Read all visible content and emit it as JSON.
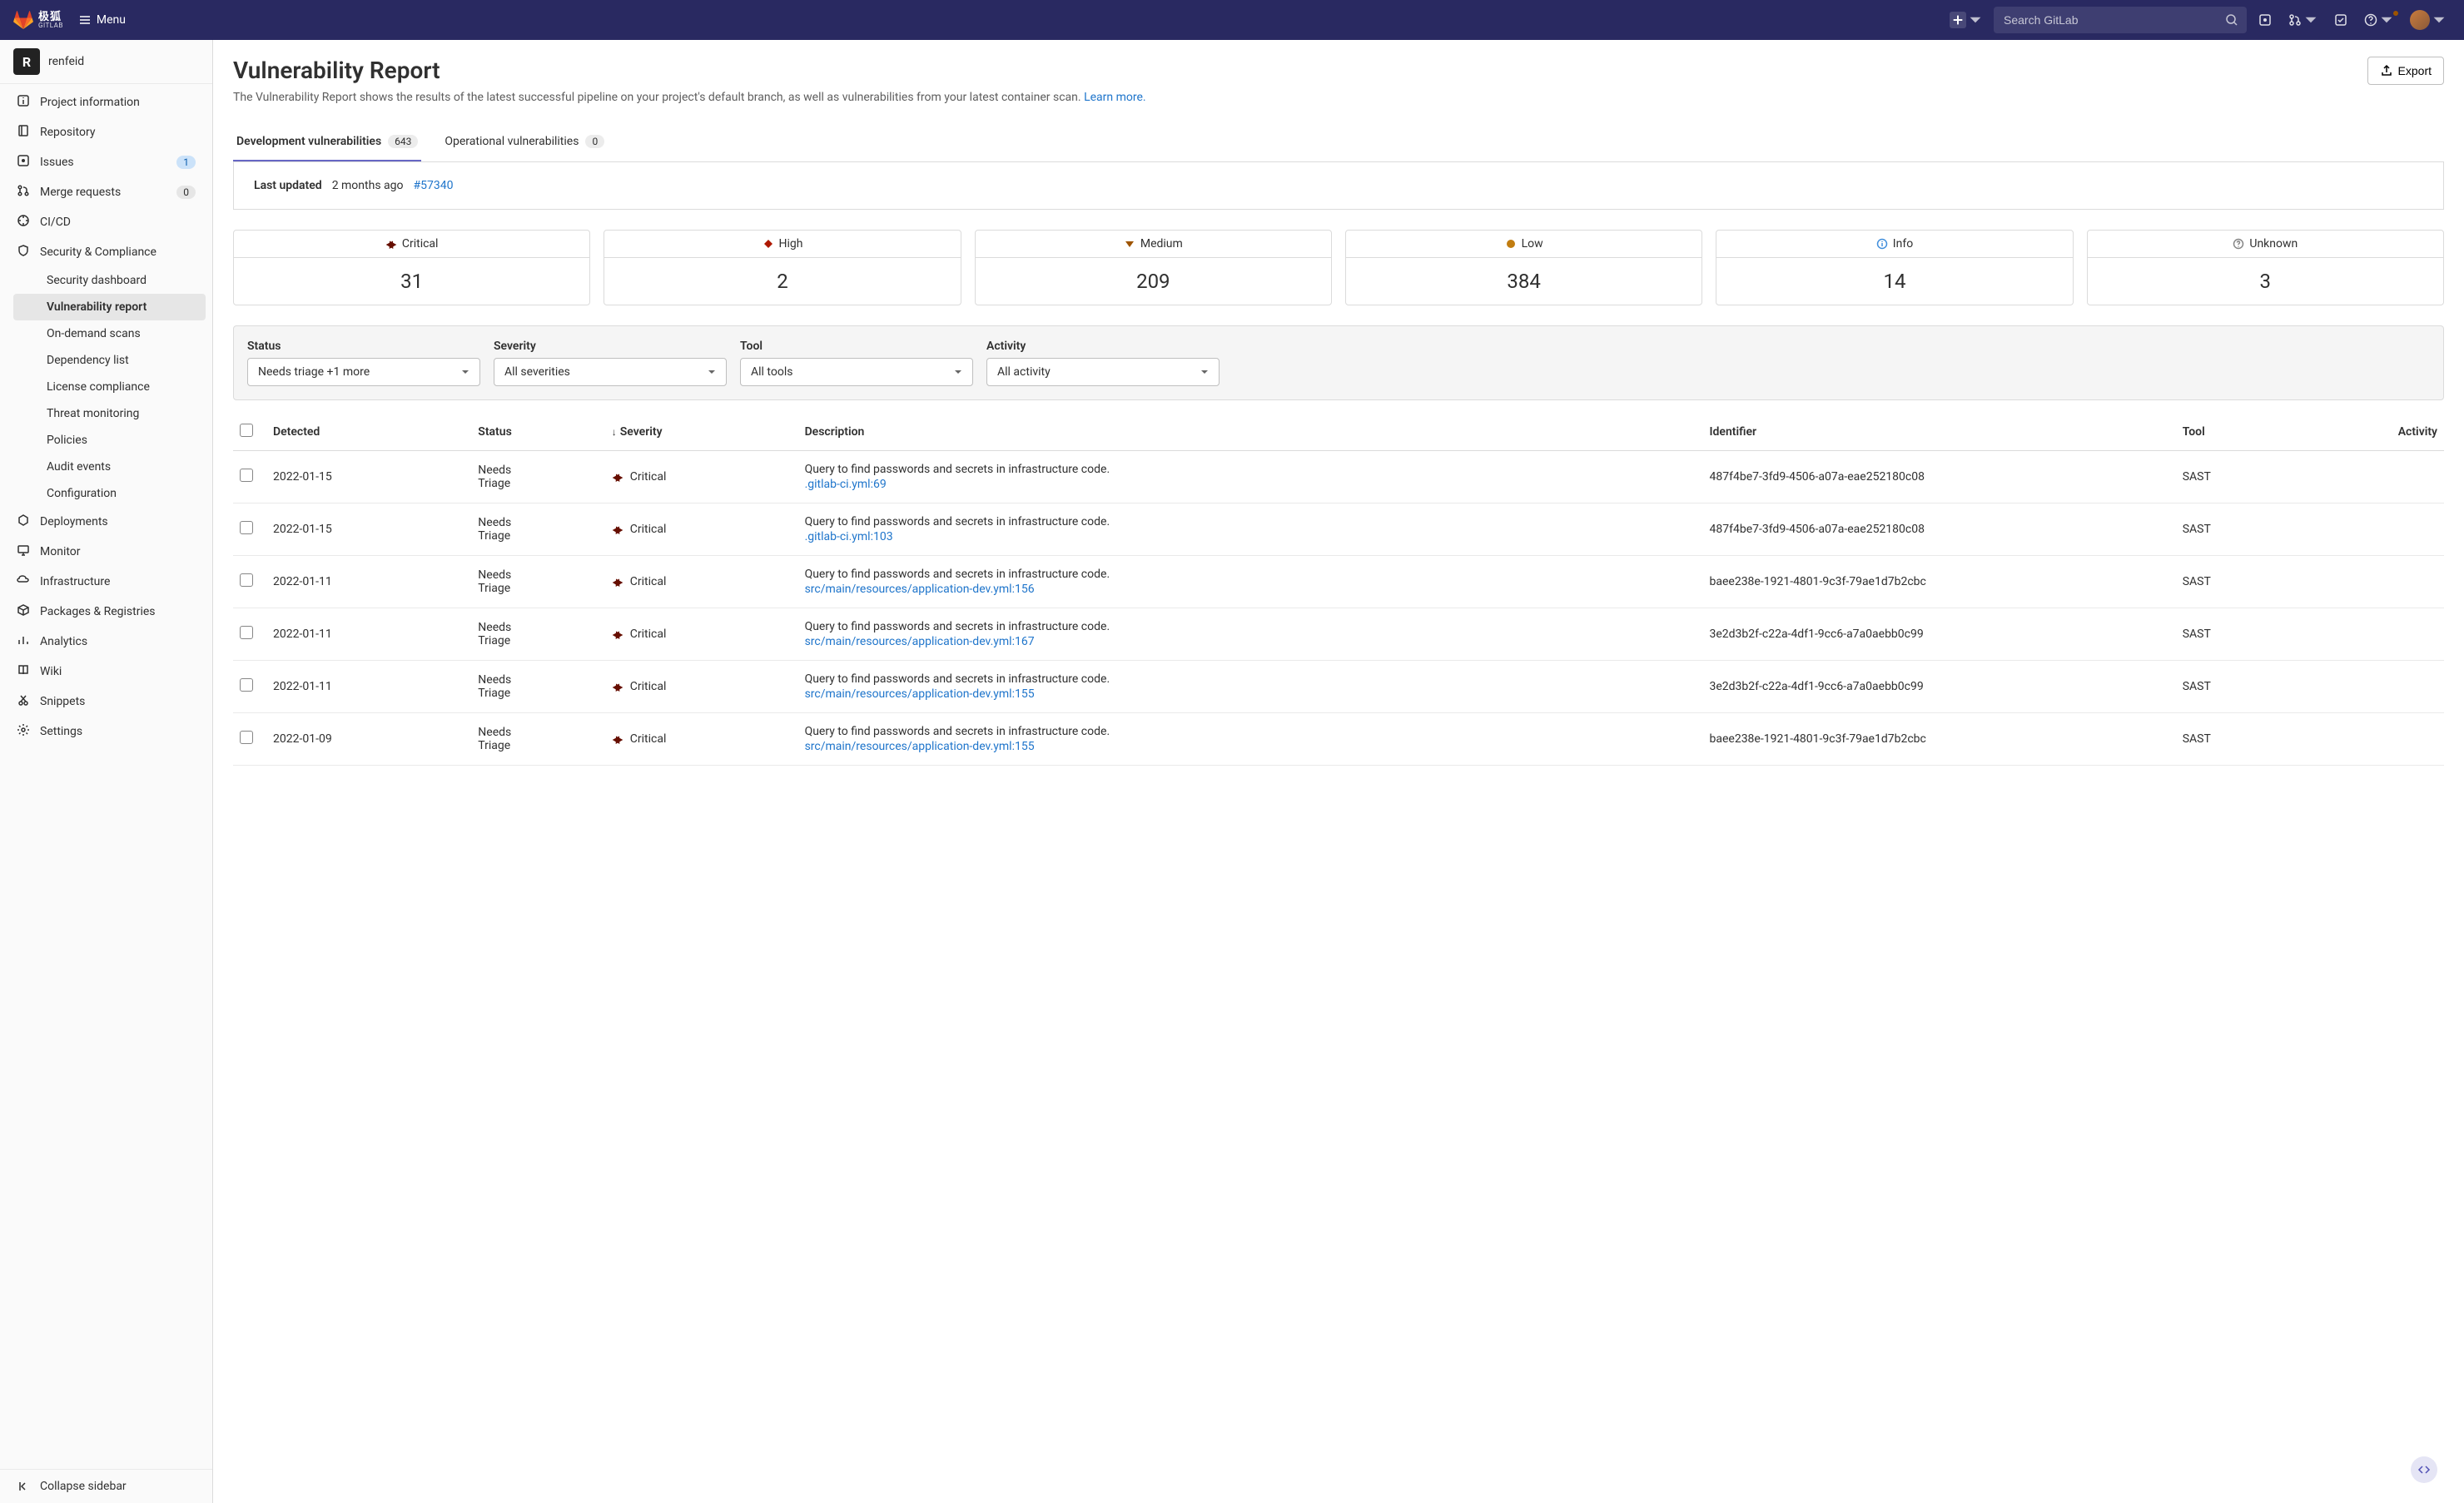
{
  "navbar": {
    "brand_cn": "极狐",
    "brand_sub": "GITLAB",
    "menu_label": "Menu",
    "search_placeholder": "Search GitLab"
  },
  "sidebar": {
    "project_initial": "R",
    "project_name": "renfeid",
    "items": [
      {
        "label": "Project information",
        "icon": "info"
      },
      {
        "label": "Repository",
        "icon": "repo"
      },
      {
        "label": "Issues",
        "icon": "issues",
        "badge": "1",
        "badge_style": "blue"
      },
      {
        "label": "Merge requests",
        "icon": "merge",
        "badge": "0"
      },
      {
        "label": "CI/CD",
        "icon": "cicd"
      },
      {
        "label": "Security & Compliance",
        "icon": "shield"
      }
    ],
    "sub_items": [
      {
        "label": "Security dashboard"
      },
      {
        "label": "Vulnerability report",
        "active": true
      },
      {
        "label": "On-demand scans"
      },
      {
        "label": "Dependency list"
      },
      {
        "label": "License compliance"
      },
      {
        "label": "Threat monitoring"
      },
      {
        "label": "Policies"
      },
      {
        "label": "Audit events"
      },
      {
        "label": "Configuration"
      }
    ],
    "items_after": [
      {
        "label": "Deployments",
        "icon": "deploy"
      },
      {
        "label": "Monitor",
        "icon": "monitor"
      },
      {
        "label": "Infrastructure",
        "icon": "infra"
      },
      {
        "label": "Packages & Registries",
        "icon": "packages"
      },
      {
        "label": "Analytics",
        "icon": "analytics"
      },
      {
        "label": "Wiki",
        "icon": "wiki"
      },
      {
        "label": "Snippets",
        "icon": "snippets"
      },
      {
        "label": "Settings",
        "icon": "settings"
      }
    ],
    "collapse_label": "Collapse sidebar"
  },
  "page": {
    "title": "Vulnerability Report",
    "subtitle_text": "The Vulnerability Report shows the results of the latest successful pipeline on your project's default branch, as well as vulnerabilities from your latest container scan. ",
    "learn_more": "Learn more.",
    "export_label": "Export"
  },
  "tabs": [
    {
      "label": "Development vulnerabilities",
      "count": "643",
      "active": true
    },
    {
      "label": "Operational vulnerabilities",
      "count": "0"
    }
  ],
  "updated": {
    "label": "Last updated",
    "time": "2 months ago",
    "link": "#57340"
  },
  "severity_cards": [
    {
      "label": "Critical",
      "count": "31",
      "cls": "critical"
    },
    {
      "label": "High",
      "count": "2",
      "cls": "high"
    },
    {
      "label": "Medium",
      "count": "209",
      "cls": "medium"
    },
    {
      "label": "Low",
      "count": "384",
      "cls": "low"
    },
    {
      "label": "Info",
      "count": "14",
      "cls": "info"
    },
    {
      "label": "Unknown",
      "count": "3",
      "cls": "unknown"
    }
  ],
  "filters": {
    "status": {
      "label": "Status",
      "value": "Needs triage +1 more"
    },
    "severity": {
      "label": "Severity",
      "value": "All severities"
    },
    "tool": {
      "label": "Tool",
      "value": "All tools"
    },
    "activity": {
      "label": "Activity",
      "value": "All activity"
    }
  },
  "table": {
    "headers": {
      "detected": "Detected",
      "status": "Status",
      "severity": "Severity",
      "description": "Description",
      "identifier": "Identifier",
      "tool": "Tool",
      "activity": "Activity"
    },
    "rows": [
      {
        "detected": "2022-01-15",
        "status": "Needs Triage",
        "severity": "Critical",
        "desc": "Query to find passwords and secrets in infrastructure code.",
        "link": ".gitlab-ci.yml:69",
        "identifier": "487f4be7-3fd9-4506-a07a-eae252180c08",
        "tool": "SAST"
      },
      {
        "detected": "2022-01-15",
        "status": "Needs Triage",
        "severity": "Critical",
        "desc": "Query to find passwords and secrets in infrastructure code.",
        "link": ".gitlab-ci.yml:103",
        "identifier": "487f4be7-3fd9-4506-a07a-eae252180c08",
        "tool": "SAST"
      },
      {
        "detected": "2022-01-11",
        "status": "Needs Triage",
        "severity": "Critical",
        "desc": "Query to find passwords and secrets in infrastructure code.",
        "link": "src/main/resources/application-dev.yml:156",
        "identifier": "baee238e-1921-4801-9c3f-79ae1d7b2cbc",
        "tool": "SAST"
      },
      {
        "detected": "2022-01-11",
        "status": "Needs Triage",
        "severity": "Critical",
        "desc": "Query to find passwords and secrets in infrastructure code.",
        "link": "src/main/resources/application-dev.yml:167",
        "identifier": "3e2d3b2f-c22a-4df1-9cc6-a7a0aebb0c99",
        "tool": "SAST"
      },
      {
        "detected": "2022-01-11",
        "status": "Needs Triage",
        "severity": "Critical",
        "desc": "Query to find passwords and secrets in infrastructure code.",
        "link": "src/main/resources/application-dev.yml:155",
        "identifier": "3e2d3b2f-c22a-4df1-9cc6-a7a0aebb0c99",
        "tool": "SAST"
      },
      {
        "detected": "2022-01-09",
        "status": "Needs Triage",
        "severity": "Critical",
        "desc": "Query to find passwords and secrets in infrastructure code.",
        "link": "src/main/resources/application-dev.yml:155",
        "identifier": "baee238e-1921-4801-9c3f-79ae1d7b2cbc",
        "tool": "SAST"
      }
    ]
  }
}
